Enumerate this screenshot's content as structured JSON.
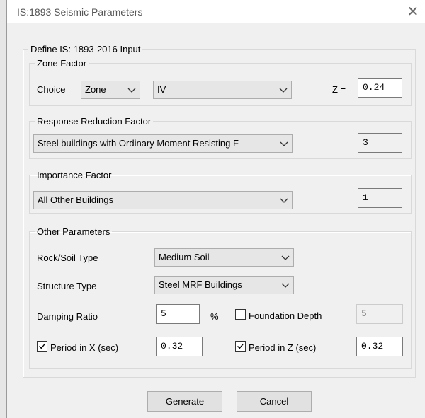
{
  "window": {
    "title": "IS:1893 Seismic Parameters",
    "close_glyph": "✕"
  },
  "define_group": {
    "label": "Define IS: 1893-2016 Input"
  },
  "zone_factor": {
    "label": "Zone Factor",
    "choice_label": "Choice",
    "choice_value": "Zone",
    "zone_value": "IV",
    "z_label": "Z =",
    "z_value": "0.24"
  },
  "response_reduction": {
    "label": "Response Reduction Factor",
    "selected": "Steel buildings with Ordinary Moment Resisting F",
    "value": "3"
  },
  "importance": {
    "label": "Importance Factor",
    "selected": "All Other Buildings",
    "value": "1"
  },
  "other": {
    "label": "Other Parameters",
    "soil_label": "Rock/Soil Type",
    "soil_value": "Medium Soil",
    "structure_label": "Structure Type",
    "structure_value": "Steel MRF Buildings",
    "damping_label": "Damping Ratio",
    "damping_value": "5",
    "damping_unit": "%",
    "foundation_label": "Foundation Depth",
    "foundation_checked": false,
    "foundation_value": "5",
    "period_x_label": "Period in X (sec)",
    "period_x_checked": true,
    "period_x_value": "0.32",
    "period_z_label": "Period in Z (sec)",
    "period_z_checked": true,
    "period_z_value": "0.32"
  },
  "buttons": {
    "generate": "Generate",
    "cancel": "Cancel"
  },
  "icons": {
    "dropdown": "chevron-down-icon",
    "check": "checkmark-icon",
    "close": "close-icon"
  }
}
